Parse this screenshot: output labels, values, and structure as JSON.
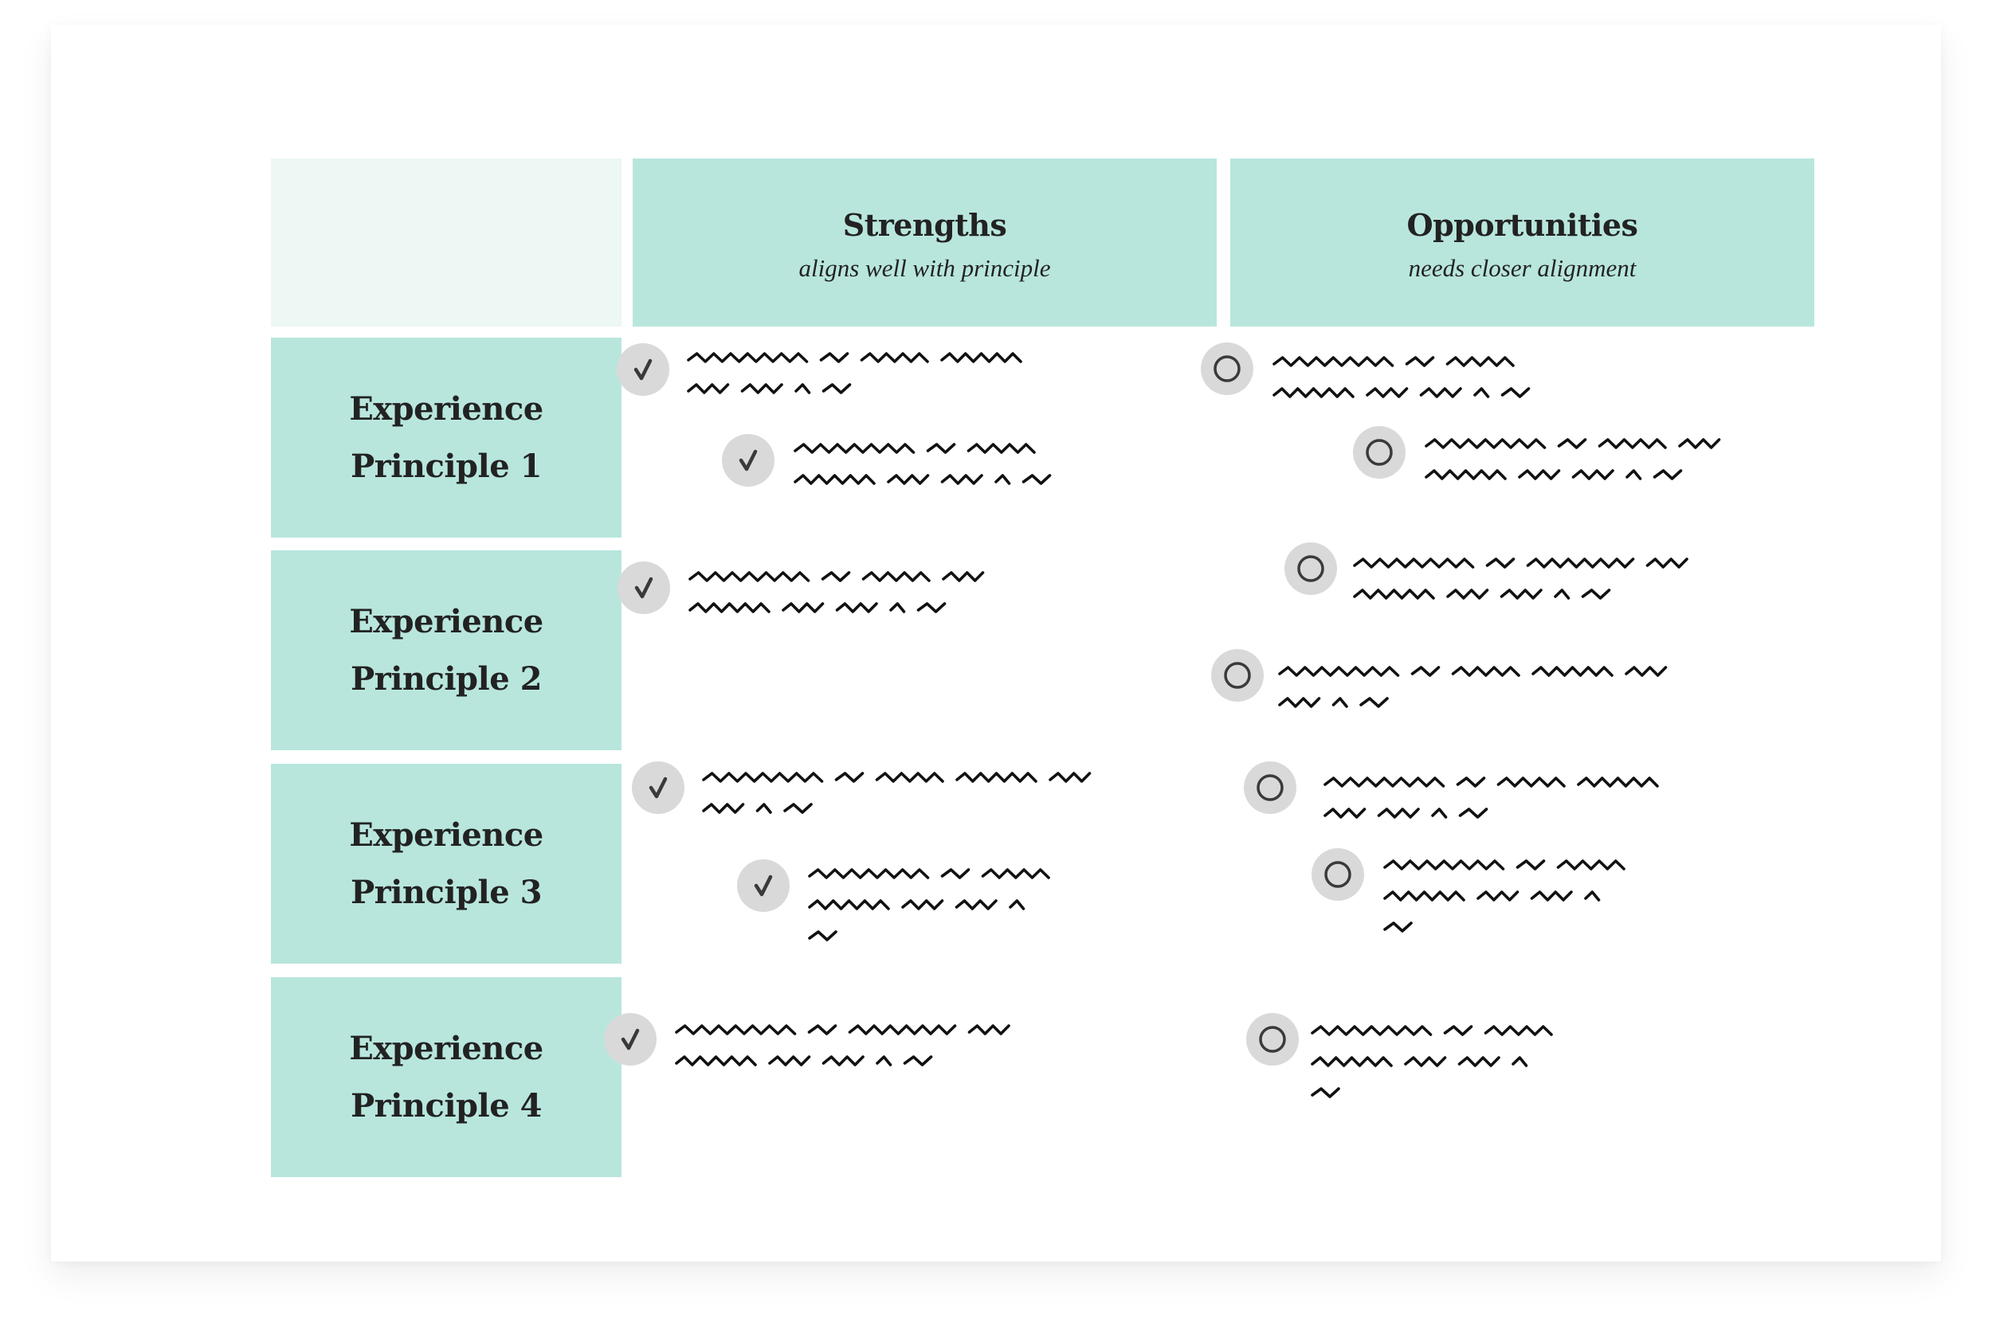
{
  "colors": {
    "header_fill": "#b8e6dd",
    "corner_fill": "#edf7f4",
    "badge_fill": "#d9d9d9",
    "icon_stroke": "#3a3a3a",
    "scribble_ink": "#111111"
  },
  "columns": [
    {
      "key": "strengths",
      "title": "Strengths",
      "subtitle": "aligns well with principle",
      "icon": "check-icon"
    },
    {
      "key": "opportunities",
      "title": "Opportunities",
      "subtitle": "needs closer alignment",
      "icon": "ring-icon"
    }
  ],
  "rows": [
    {
      "label": "Experience\nPrinciple 1"
    },
    {
      "label": "Experience\nPrinciple 2"
    },
    {
      "label": "Experience\nPrinciple 3"
    },
    {
      "label": "Experience\nPrinciple 4"
    }
  ],
  "items": {
    "strengths": [
      {
        "row": 1,
        "placeholder_text": true,
        "word_lengths_per_line": [
          [
            9,
            2,
            5,
            6
          ],
          [
            3,
            3,
            1,
            2
          ]
        ]
      },
      {
        "row": 1,
        "placeholder_text": true,
        "word_lengths_per_line": [
          [
            9,
            2,
            5
          ],
          [
            6,
            3,
            3,
            1,
            2
          ]
        ]
      },
      {
        "row": 2,
        "placeholder_text": true,
        "word_lengths_per_line": [
          [
            9,
            2,
            5,
            3
          ],
          [
            6,
            3,
            3,
            1,
            2
          ]
        ]
      },
      {
        "row": 3,
        "placeholder_text": true,
        "word_lengths_per_line": [
          [
            9,
            2,
            5,
            6,
            3
          ],
          [
            3,
            1,
            2
          ]
        ]
      },
      {
        "row": 3,
        "placeholder_text": true,
        "word_lengths_per_line": [
          [
            9,
            2,
            5
          ],
          [
            6,
            3,
            3,
            1
          ],
          [
            2
          ]
        ]
      },
      {
        "row": 4,
        "placeholder_text": true,
        "word_lengths_per_line": [
          [
            9,
            2,
            8,
            3
          ],
          [
            6,
            3,
            3,
            1,
            2
          ]
        ]
      }
    ],
    "opportunities": [
      {
        "row": 1,
        "placeholder_text": true,
        "word_lengths_per_line": [
          [
            9,
            2,
            5
          ],
          [
            6,
            3,
            3,
            1,
            2
          ]
        ]
      },
      {
        "row": 1,
        "placeholder_text": true,
        "word_lengths_per_line": [
          [
            9,
            2,
            5,
            3
          ],
          [
            6,
            3,
            3,
            1,
            2
          ]
        ]
      },
      {
        "row": 2,
        "placeholder_text": true,
        "word_lengths_per_line": [
          [
            9,
            2,
            8,
            3
          ],
          [
            6,
            3,
            3,
            1,
            2
          ]
        ]
      },
      {
        "row": 2,
        "placeholder_text": true,
        "word_lengths_per_line": [
          [
            9,
            2,
            5,
            6,
            3
          ],
          [
            3,
            1,
            2
          ]
        ]
      },
      {
        "row": 3,
        "placeholder_text": true,
        "word_lengths_per_line": [
          [
            9,
            2,
            5,
            6
          ],
          [
            3,
            3,
            1,
            2
          ]
        ]
      },
      {
        "row": 3,
        "placeholder_text": true,
        "word_lengths_per_line": [
          [
            9,
            2,
            5
          ],
          [
            6,
            3,
            3,
            1
          ],
          [
            2
          ]
        ]
      },
      {
        "row": 4,
        "placeholder_text": true,
        "word_lengths_per_line": [
          [
            9,
            2,
            5
          ],
          [
            6,
            3,
            3,
            1
          ],
          [
            2
          ]
        ]
      }
    ]
  }
}
